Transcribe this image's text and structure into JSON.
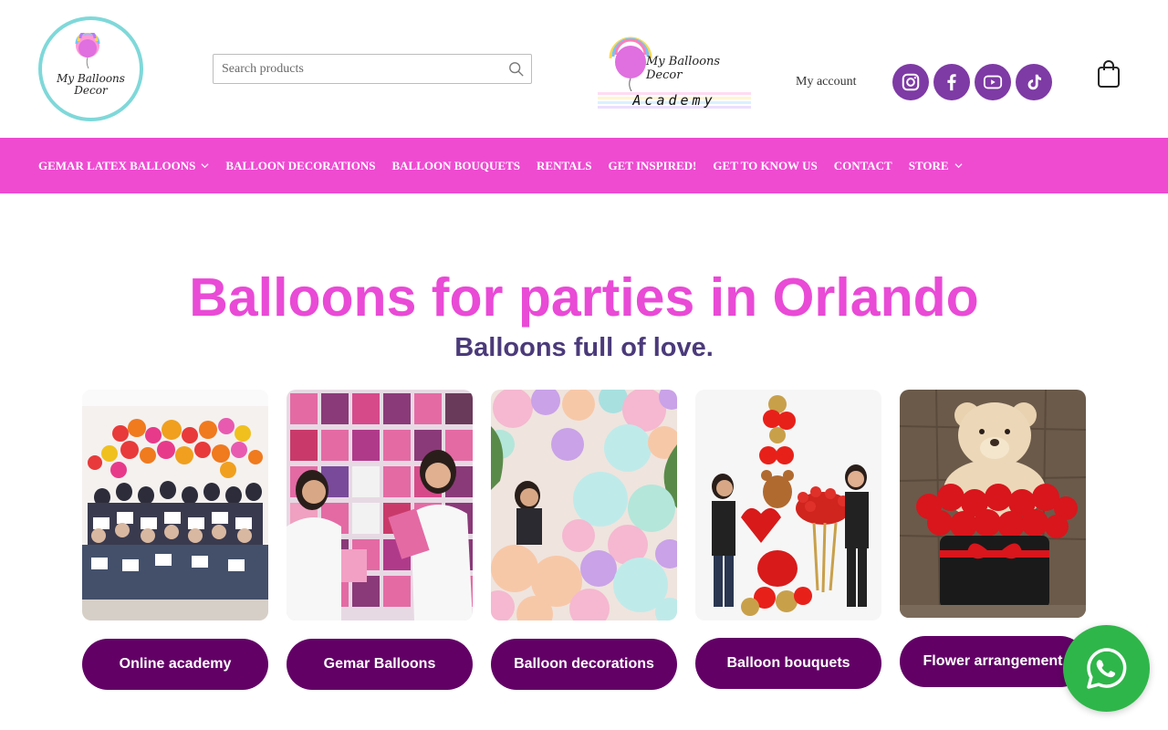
{
  "header": {
    "logo_text": "My Balloons Decor",
    "academy_brand": "My Balloons Decor",
    "academy_word": "Academy",
    "search_placeholder": "Search products",
    "my_account": "My account",
    "social_icons": [
      "instagram-icon",
      "facebook-icon",
      "youtube-icon",
      "tiktok-icon"
    ],
    "cart_icon": "shopping-bag-icon"
  },
  "nav": {
    "items": [
      {
        "label": "GEMAR LATEX BALLOONS",
        "dropdown": true
      },
      {
        "label": "BALLOON DECORATIONS",
        "dropdown": false
      },
      {
        "label": "BALLOON BOUQUETS",
        "dropdown": false
      },
      {
        "label": "RENTALS",
        "dropdown": false
      },
      {
        "label": "GET INSPIRED!",
        "dropdown": false
      },
      {
        "label": "GET TO KNOW US",
        "dropdown": false
      },
      {
        "label": "CONTACT",
        "dropdown": false
      },
      {
        "label": "STORE",
        "dropdown": true
      }
    ]
  },
  "hero": {
    "title": "Balloons for parties in Orlando",
    "subtitle": "Balloons full of love."
  },
  "cards": [
    {
      "button": "Online academy"
    },
    {
      "button": "Gemar Balloons"
    },
    {
      "button": "Balloon decorations"
    },
    {
      "button": "Balloon bouquets"
    },
    {
      "button": "Flower arrangement"
    }
  ],
  "floating": {
    "icon": "whatsapp-icon"
  },
  "colors": {
    "nav_bg": "#ee4bd1",
    "title": "#e94ad6",
    "subtitle": "#4b3a7a",
    "button_bg": "#620066",
    "social_bg": "#7e3aa5",
    "whatsapp_bg": "#2fb64a",
    "logo_ring": "#7fd8d9"
  }
}
